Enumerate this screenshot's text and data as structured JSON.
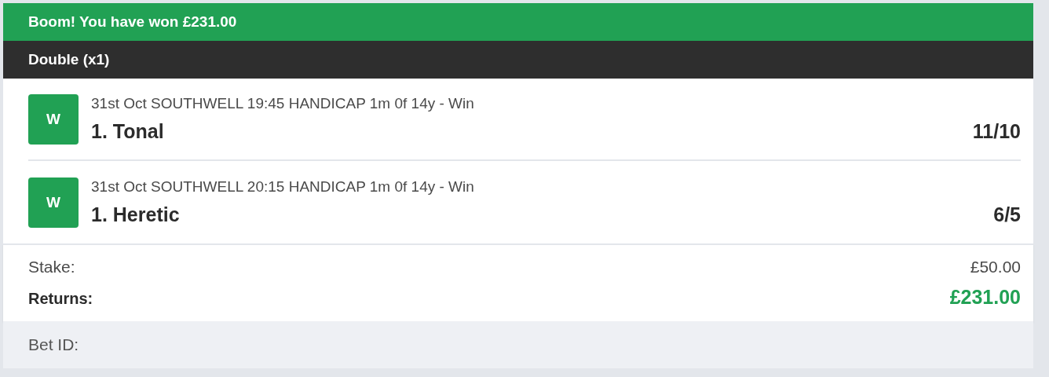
{
  "banner": {
    "title": "Boom! You have won £231.00"
  },
  "bet_type": "Double (x1)",
  "selections": [
    {
      "result": "W",
      "event": "31st Oct SOUTHWELL 19:45 HANDICAP 1m 0f 14y - Win",
      "runner": "1. Tonal",
      "odds": "11/10"
    },
    {
      "result": "W",
      "event": "31st Oct SOUTHWELL 20:15 HANDICAP 1m 0f 14y - Win",
      "runner": "1. Heretic",
      "odds": "6/5"
    }
  ],
  "summary": [
    {
      "kind": "plain",
      "label": "Stake:",
      "value": "£50.00"
    },
    {
      "kind": "total",
      "label": "Returns:",
      "value": "£231.00"
    }
  ],
  "footer": {
    "label": "Bet ID:"
  }
}
